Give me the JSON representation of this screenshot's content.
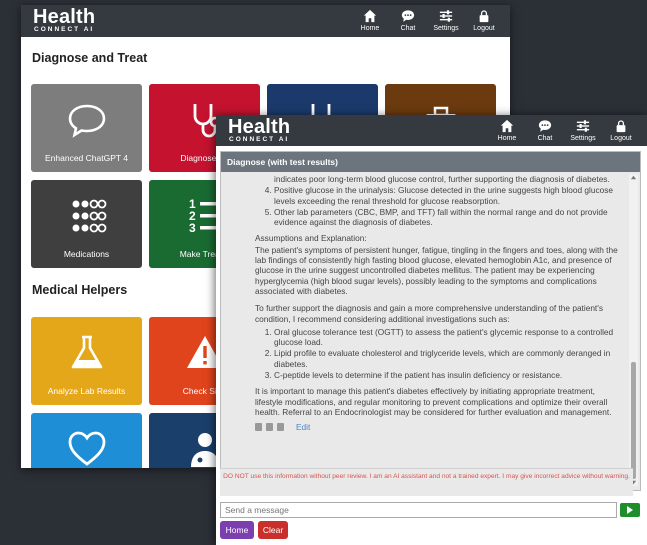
{
  "app": {
    "brand": "Health",
    "brand_sub": "CONNECT AI"
  },
  "nav": [
    {
      "label": "Home",
      "icon": "home-icon"
    },
    {
      "label": "Chat",
      "icon": "chat-icon"
    },
    {
      "label": "Settings",
      "icon": "settings-icon"
    },
    {
      "label": "Logout",
      "icon": "lock-icon"
    }
  ],
  "back": {
    "diagnose_title": "Diagnose and Treat",
    "helpers_title": "Medical Helpers",
    "tiles": [
      {
        "label": "Enhanced ChatGPT 4",
        "color": "#7d7d7d",
        "icon": "speech-bubble-icon"
      },
      {
        "label": "Diagnose Sy",
        "color": "#c4122f",
        "icon": "stethoscope-icon"
      },
      {
        "label": "",
        "color": "#1b3a6b",
        "icon": "stethoscope-icon"
      },
      {
        "label": "",
        "color": "#6b3a0e",
        "icon": "briefcase-icon"
      },
      {
        "label": "Medications",
        "color": "#3f3f3f",
        "icon": "pills-grid-icon"
      },
      {
        "label": "Make Treatm",
        "color": "#1a6b32",
        "icon": "numbered-list-icon"
      },
      {
        "label": "Analyze Lab Results",
        "color": "#e5a71a",
        "icon": "flask-icon"
      },
      {
        "label": "Check Side",
        "color": "#e0441c",
        "icon": "warning-icon"
      },
      {
        "label": "",
        "color": "#1e8fd6",
        "icon": "heart-icon"
      },
      {
        "label": "",
        "color": "#1b3f6b",
        "icon": "doctor-icon"
      }
    ]
  },
  "front": {
    "card_title": "Diagnose (with test results)",
    "lead_in": "indicates poor long-term blood glucose control, further supporting the diagnosis of diabetes.",
    "findings": [
      "Positive glucose in the urinalysis: Glucose detected in the urine suggests high blood glucose levels exceeding the renal threshold for glucose reabsorption.",
      "Other lab parameters (CBC, BMP, and TFT) fall within the normal range and do not provide evidence against the diagnosis of diabetes."
    ],
    "assumptions_heading": "Assumptions and Explanation:",
    "assumptions_text": "The patient's symptoms of persistent hunger, fatigue, tingling in the fingers and toes, along with the lab findings of consistently high fasting blood glucose, elevated hemoglobin A1c, and presence of glucose in the urine suggest uncontrolled diabetes mellitus. The patient may be experiencing hyperglycemia (high blood sugar levels), possibly leading to the symptoms and complications associated with diabetes.",
    "further_text": "To further support the diagnosis and gain a more comprehensive understanding of the patient's condition, I recommend considering additional investigations such as:",
    "investigations": [
      "Oral glucose tolerance test (OGTT) to assess the patient's glycemic response to a controlled glucose load.",
      "Lipid profile to evaluate cholesterol and triglyceride levels, which are commonly deranged in diabetes.",
      "C-peptide levels to determine if the patient has insulin deficiency or resistance."
    ],
    "closing_text": "It is important to manage this patient's diabetes effectively by initiating appropriate treatment, lifestyle modifications, and regular monitoring to prevent complications and optimize their overall health. Referral to an Endocrinologist may be considered for further evaluation and management.",
    "edit_label": "Edit",
    "disclaimer": "DO NOT use this information without peer review. I am an AI assistant and not a trained expert. I may give incorrect advice without warning.",
    "input_placeholder": "Send a message",
    "home_button": "Home",
    "clear_button": "Clear"
  }
}
